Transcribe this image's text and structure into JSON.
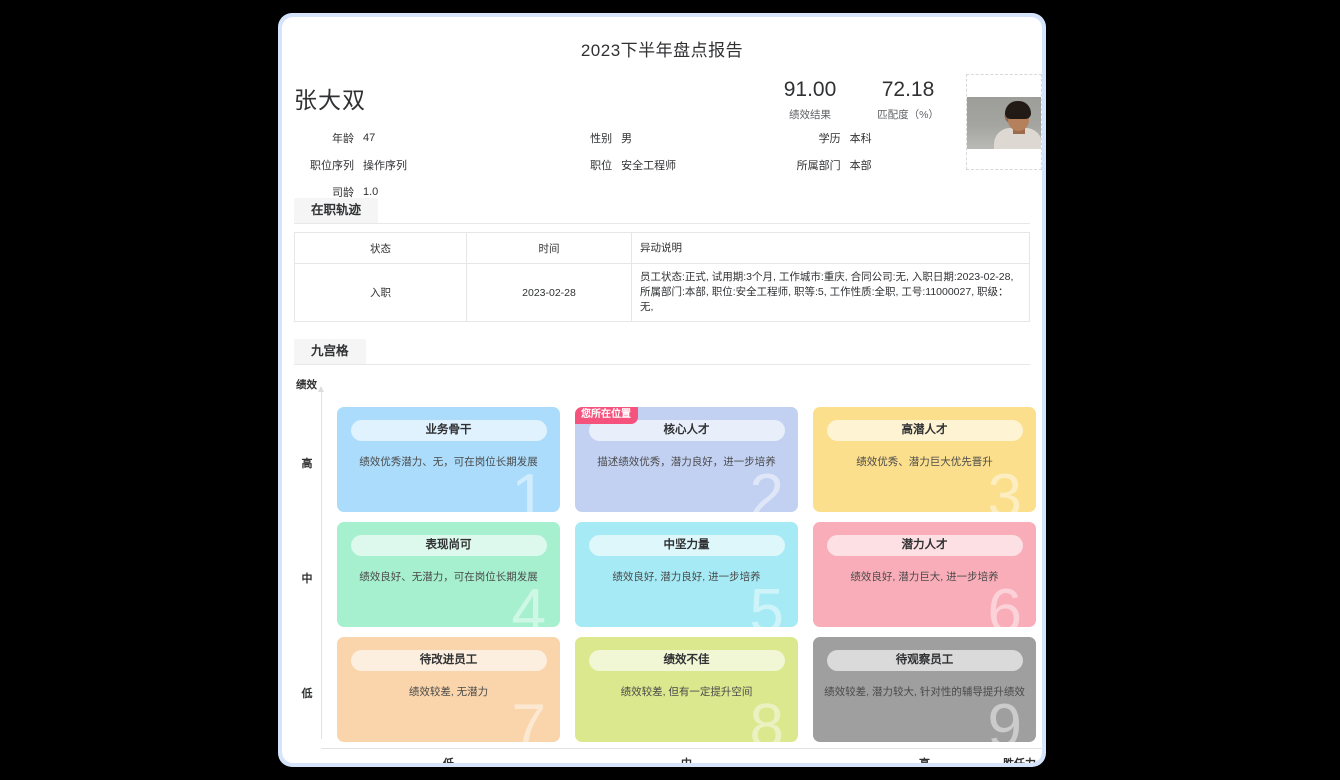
{
  "report": {
    "title": "2023下半年盘点报告"
  },
  "profile": {
    "name": "张大双",
    "scores": [
      {
        "value": "91.00",
        "label": "绩效结果"
      },
      {
        "value": "72.18",
        "label": "匹配度（%）"
      }
    ],
    "avatar_alt": "员工头像",
    "fields": [
      [
        {
          "label": "年龄",
          "value": "47"
        },
        {
          "label": "性别",
          "value": "男"
        },
        {
          "label": "学历",
          "value": "本科"
        }
      ],
      [
        {
          "label": "职位序列",
          "value": "操作序列"
        },
        {
          "label": "职位",
          "value": "安全工程师"
        },
        {
          "label": "所属部门",
          "value": "本部"
        }
      ],
      [
        {
          "label": "司龄",
          "value": "1.0"
        },
        {
          "label": "",
          "value": ""
        },
        {
          "label": "",
          "value": ""
        }
      ]
    ]
  },
  "track_section": {
    "tab_label": "在职轨迹",
    "columns": [
      "状态",
      "时间",
      "异动说明"
    ],
    "rows": [
      {
        "status": "入职",
        "time": "2023-02-28",
        "note": "员工状态:正式, 试用期:3个月, 工作城市:重庆, 合同公司:无, 入职日期:2023-02-28, 所属部门:本部, 职位:安全工程师, 职等:5, 工作性质:全职, 工号:11000027, 职级：无,"
      }
    ]
  },
  "nine_grid": {
    "tab_label": "九宫格",
    "y_axis_title": "绩效",
    "x_axis_title": "胜任力",
    "y_labels": [
      "高",
      "中",
      "低"
    ],
    "x_labels": [
      "低",
      "中",
      "高"
    ],
    "here_badge": "您所在位置",
    "cells": [
      {
        "num": "1",
        "title": "业务骨干",
        "desc": "绩效优秀潜力、无，可在岗位长期发展",
        "color": "#abdcfb",
        "here": false
      },
      {
        "num": "2",
        "title": "核心人才",
        "desc": "描述绩效优秀，潜力良好，进一步培养",
        "color": "#c2d1f2",
        "here": true
      },
      {
        "num": "3",
        "title": "高潜人才",
        "desc": "绩效优秀、潜力巨大优先晋升",
        "color": "#fbdf8c",
        "here": false
      },
      {
        "num": "4",
        "title": "表现尚可",
        "desc": "绩效良好、无潜力，可在岗位长期发展",
        "color": "#a6f0cf",
        "here": false
      },
      {
        "num": "5",
        "title": "中坚力量",
        "desc": "绩效良好, 潜力良好, 进一步培养",
        "color": "#a5eaf5",
        "here": false
      },
      {
        "num": "6",
        "title": "潜力人才",
        "desc": "绩效良好, 潜力巨大, 进一步培养",
        "color": "#f9adb9",
        "here": false
      },
      {
        "num": "7",
        "title": "待改进员工",
        "desc": "绩效较差, 无潜力",
        "color": "#fad4ab",
        "here": false
      },
      {
        "num": "8",
        "title": "绩效不佳",
        "desc": "绩效较差, 但有一定提升空间",
        "color": "#dbe88e",
        "here": false
      },
      {
        "num": "9",
        "title": "待观察员工",
        "desc": "绩效较差, 潜力较大, 针对性的辅导提升绩效",
        "color": "#9f9f9f",
        "here": false
      }
    ]
  },
  "theme": {
    "frame_color": "#d6e4fb",
    "badge_color": "#f5527d",
    "text_color": "#303133"
  }
}
